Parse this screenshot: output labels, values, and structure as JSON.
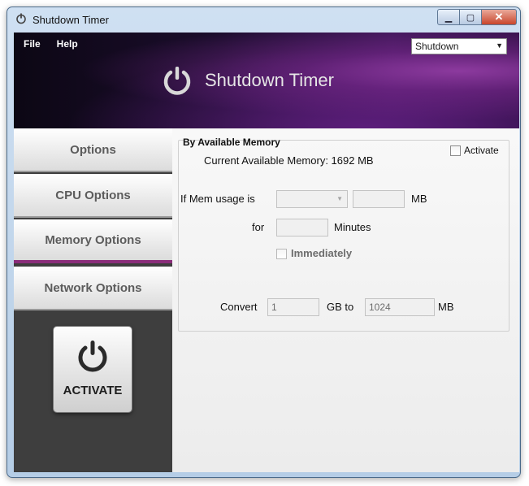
{
  "window": {
    "title": "Shutdown Timer"
  },
  "menu": {
    "file": "File",
    "help": "Help"
  },
  "header": {
    "brand": "Shutdown Timer",
    "mode_selected": "Shutdown"
  },
  "sidebar": {
    "items": [
      {
        "label": "Options"
      },
      {
        "label": "CPU Options"
      },
      {
        "label": "Memory Options"
      },
      {
        "label": "Network Options"
      }
    ],
    "active_item": "Memory Options",
    "activate_label": "ACTIVATE"
  },
  "panel": {
    "title": "By Available Memory",
    "activate_checkbox_label": "Activate",
    "activate_checked": false,
    "current_memory_text": "Current Available Memory: 1692 MB",
    "mem_usage_label": "If Mem usage is",
    "mem_usage_operator": "",
    "mem_usage_value": "",
    "mb_unit": "MB",
    "for_label": "for",
    "minutes_value": "",
    "minutes_label": "Minutes",
    "immediately_label": "Immediately",
    "immediately_checked": false,
    "convert_label": "Convert",
    "gb_value": "1",
    "gb_to_label": "GB to",
    "mb_value": "1024",
    "mb_label": "MB"
  },
  "colors": {
    "accent": "#8a2d7a",
    "header_dark": "#1b0d2c"
  },
  "icons": {
    "power": "power-icon"
  }
}
